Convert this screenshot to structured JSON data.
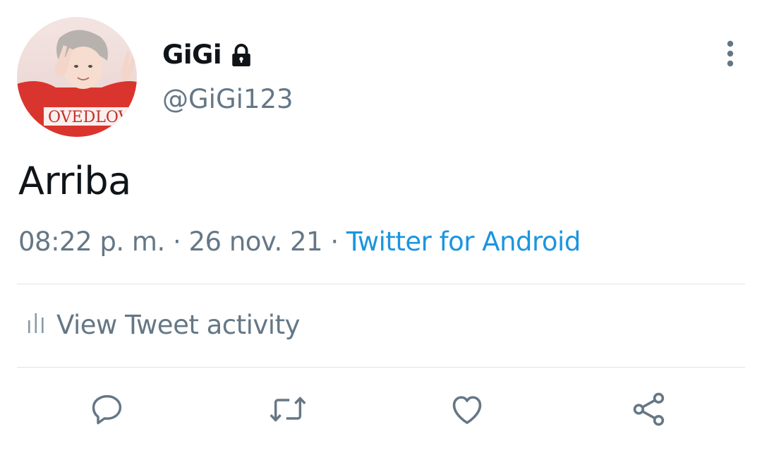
{
  "tweet": {
    "author": {
      "display_name": "GiGi",
      "handle": "@GiGi123",
      "protected": true,
      "avatar_shirt_text": "OVEDLOVE"
    },
    "text": "Arriba",
    "time": "08:22 p. m.",
    "separator": "·",
    "date": "26 nov. 21",
    "source": "Twitter for Android"
  },
  "activity": {
    "label": "View Tweet activity",
    "icon": "bar-chart-icon"
  },
  "actions": [
    {
      "name": "reply",
      "icon": "reply-icon"
    },
    {
      "name": "retweet",
      "icon": "retweet-icon"
    },
    {
      "name": "like",
      "icon": "heart-icon"
    },
    {
      "name": "share",
      "icon": "share-icon"
    }
  ],
  "colors": {
    "text_primary": "#0f1419",
    "text_secondary": "#657786",
    "link": "#1b95e0",
    "divider": "#dfe3e6"
  }
}
